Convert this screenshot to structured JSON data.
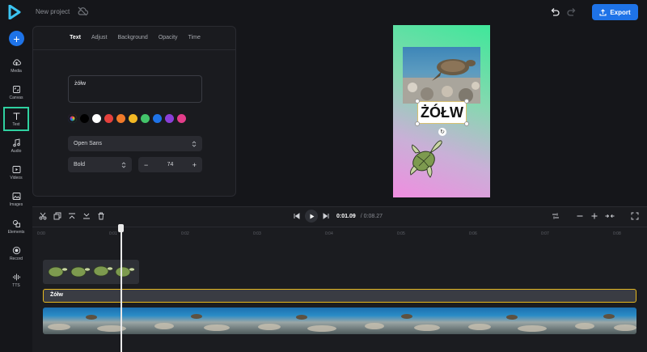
{
  "topbar": {
    "project_title": "New project",
    "export_label": "Export"
  },
  "sidebar": {
    "items": [
      {
        "label": "Media",
        "icon": "cloud-upload-icon"
      },
      {
        "label": "Canvas",
        "icon": "canvas-icon"
      },
      {
        "label": "Text",
        "icon": "text-icon"
      },
      {
        "label": "Audio",
        "icon": "music-note-icon"
      },
      {
        "label": "Videos",
        "icon": "video-play-icon"
      },
      {
        "label": "Images",
        "icon": "image-icon"
      },
      {
        "label": "Elements",
        "icon": "shapes-icon"
      },
      {
        "label": "Record",
        "icon": "record-icon"
      },
      {
        "label": "TTS",
        "icon": "waveform-icon"
      }
    ],
    "active": "Text"
  },
  "panel": {
    "tabs": [
      "Text",
      "Adjust",
      "Background",
      "Opacity",
      "Time"
    ],
    "active_tab": "Text",
    "text_value": "żółw",
    "swatches": [
      "#000000",
      "#ffffff",
      "#e5413d",
      "#f07a2a",
      "#f2b824",
      "#43c46a",
      "#1e73e8",
      "#8a3fd8",
      "#e33d8a"
    ],
    "font_family": "Open Sans",
    "font_weight": "Bold",
    "font_size": "74"
  },
  "preview": {
    "caption": "ŻÓŁW"
  },
  "timeline": {
    "time_current": "0:01.09",
    "time_total": "/ 0:08.27",
    "ruler": [
      "0:00",
      "0:01",
      "0:02",
      "0:03",
      "0:04",
      "0:05",
      "0:06",
      "0:07",
      "0:08"
    ],
    "text_track_label": "Żółw"
  },
  "colors": {
    "accent": "#1e73e8",
    "active_outline": "#2fd1a0",
    "track_highlight": "#e6b820"
  }
}
